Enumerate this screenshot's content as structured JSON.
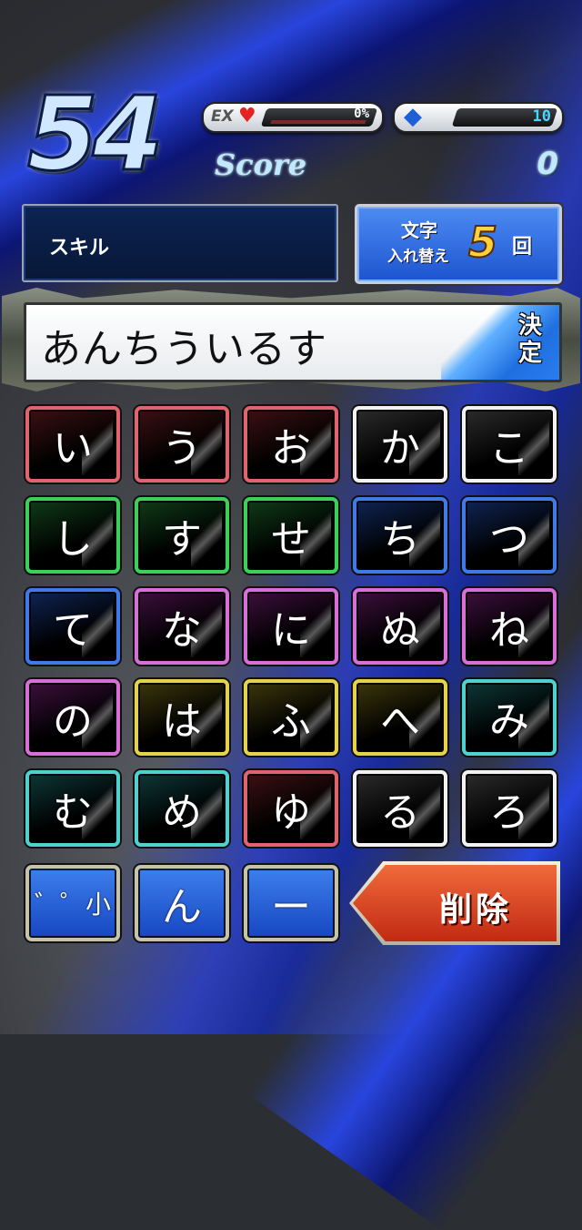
{
  "timer": "54",
  "ex_gauge": {
    "label": "EX",
    "icon": "heart-icon",
    "value": "0%",
    "fill": 0
  },
  "gem_gauge": {
    "icon": "diamond-icon",
    "value": "10"
  },
  "score": {
    "label": "Score",
    "value": "0"
  },
  "skill": {
    "label": "スキル"
  },
  "swap": {
    "top": "文字",
    "bottom": "入れ替え",
    "count": "5",
    "unit": "回"
  },
  "word": {
    "text": "あんちういるす",
    "decide_label": "決定"
  },
  "tiles": [
    {
      "char": "い",
      "color": "red"
    },
    {
      "char": "う",
      "color": "red"
    },
    {
      "char": "お",
      "color": "red"
    },
    {
      "char": "か",
      "color": "white"
    },
    {
      "char": "こ",
      "color": "white"
    },
    {
      "char": "し",
      "color": "green"
    },
    {
      "char": "す",
      "color": "green"
    },
    {
      "char": "せ",
      "color": "green"
    },
    {
      "char": "ち",
      "color": "blue"
    },
    {
      "char": "つ",
      "color": "blue"
    },
    {
      "char": "て",
      "color": "blue"
    },
    {
      "char": "な",
      "color": "purple"
    },
    {
      "char": "に",
      "color": "purple"
    },
    {
      "char": "ぬ",
      "color": "purple"
    },
    {
      "char": "ね",
      "color": "purple"
    },
    {
      "char": "の",
      "color": "purple"
    },
    {
      "char": "は",
      "color": "yellow"
    },
    {
      "char": "ふ",
      "color": "yellow"
    },
    {
      "char": "へ",
      "color": "yellow"
    },
    {
      "char": "み",
      "color": "cyan"
    },
    {
      "char": "む",
      "color": "cyan"
    },
    {
      "char": "め",
      "color": "cyan"
    },
    {
      "char": "ゆ",
      "color": "red"
    },
    {
      "char": "る",
      "color": "white"
    },
    {
      "char": "ろ",
      "color": "white"
    }
  ],
  "function_keys": [
    {
      "char": "゛゜小",
      "name": "dakuten-key"
    },
    {
      "char": "ん",
      "name": "n-key"
    },
    {
      "char": "ー",
      "name": "long-vowel-key"
    }
  ],
  "delete_label": "削除"
}
